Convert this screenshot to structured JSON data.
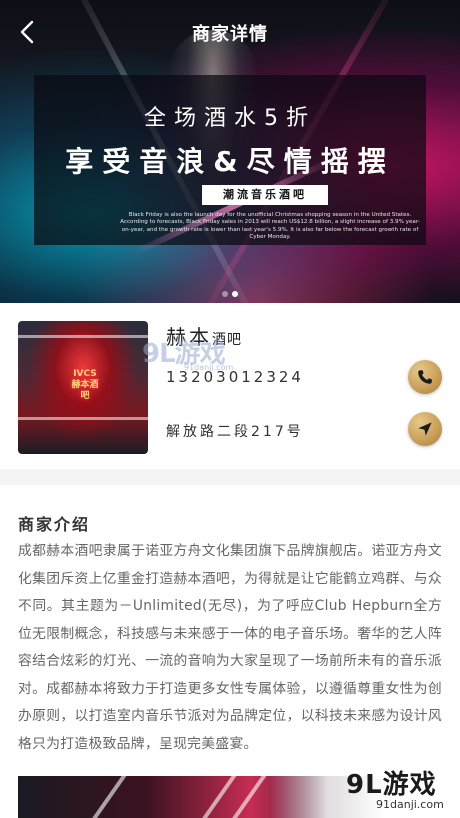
{
  "header": {
    "title": "商家详情",
    "back_icon": "chevron-left-icon"
  },
  "banner": {
    "headline": "全场酒水5折",
    "subheadline": "享受音浪&尽情摇摆",
    "tag": "潮流音乐酒吧",
    "description": "Black Friday is also the launch day for the unofficial Christmas shopping season in the United States. According to forecasts, Black Friday sales in 2013 will reach US$12.8 billion, a slight increase of 3.9% year-on-year, and the growth rate is lower than last year's 5.9%. It is also far below the forecast growth rate of Cyber Monday.",
    "slide_count": 2,
    "active_slide": 1
  },
  "store": {
    "name": "赫本",
    "name_suffix": "酒吧",
    "phone": "13203012324",
    "address": "解放路二段217号",
    "photo_sign": "IVCS 赫本酒吧",
    "phone_icon": "phone-icon",
    "navigate_icon": "navigate-arrow-icon",
    "accent_color": "#c9a15a"
  },
  "intro": {
    "heading": "商家介绍",
    "body": "成都赫本酒吧隶属于诺亚方舟文化集团旗下品牌旗舰店。诺亚方舟文化集团斥资上亿重金打造赫本酒吧，为得就是让它能鹤立鸡群、与众不同。其主题为－Unlimited(无尽)，为了呼应Club Hepburn全方位无限制概念，科技感与未来感于一体的电子音乐场。奢华的艺人阵容结合炫彩的灯光、一流的音响为大家呈现了一场前所未有的音乐派对。成都赫本将致力于打造更多女性专属体验，以遵循尊重女性为创办原则，以打造室内音乐节派对为品牌定位，以科技未来感为设计风格只为打造极致品牌，呈现完美盛宴。"
  },
  "watermarks": {
    "brand": "9L游戏",
    "site": "91danji.com"
  }
}
